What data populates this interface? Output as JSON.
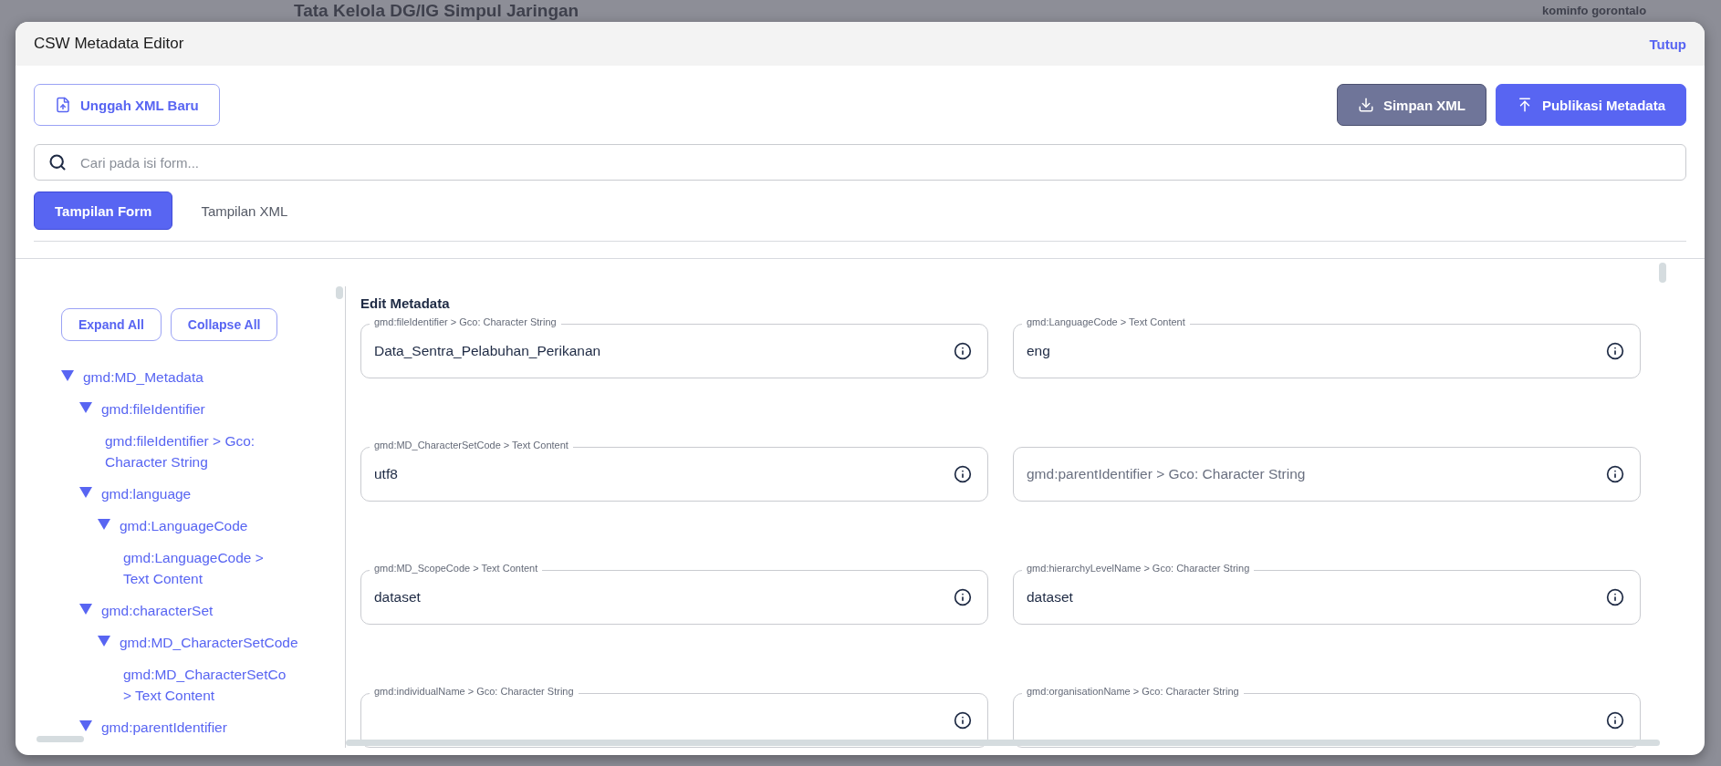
{
  "backdrop": {
    "page_title": "Tata Kelola DG/IG Simpul Jaringan",
    "user": "kominfo gorontalo"
  },
  "window": {
    "title": "CSW Metadata Editor",
    "close_label": "Tutup"
  },
  "toolbar": {
    "upload_button": "Unggah XML Baru",
    "save_button": "Simpan XML",
    "publish_button": "Publikasi Metadata"
  },
  "search": {
    "placeholder": "Cari pada isi form..."
  },
  "tabs": [
    {
      "label": "Tampilan Form",
      "selected": true
    },
    {
      "label": "Tampilan XML",
      "selected": false
    }
  ],
  "tree_buttons": [
    "Expand All",
    "Collapse All"
  ],
  "tree": [
    {
      "label": "gmd:MD_Metadata",
      "expanded": true,
      "children": [
        {
          "label": "gmd:fileIdentifier",
          "expanded": true,
          "children": [
            {
              "label": "gmd:fileIdentifier > Gco: Character String"
            }
          ]
        },
        {
          "label": "gmd:language",
          "expanded": true,
          "children": [
            {
              "label": "gmd:LanguageCode",
              "expanded": true,
              "children": [
                {
                  "label": "gmd:LanguageCode > Text Content"
                }
              ]
            }
          ]
        },
        {
          "label": "gmd:characterSet",
          "expanded": true,
          "children": [
            {
              "label": "gmd:MD_CharacterSetCode",
              "expanded": true,
              "children": [
                {
                  "label": "gmd:MD_CharacterSetCo > Text Content"
                }
              ]
            }
          ]
        },
        {
          "label": "gmd:parentIdentifier",
          "expanded": true
        }
      ]
    }
  ],
  "form": {
    "title": "Edit Metadata",
    "fields": [
      {
        "label": "gmd:fileIdentifier > Gco: Character String",
        "value": "Data_Sentra_Pelabuhan_Perikanan"
      },
      {
        "label": "gmd:LanguageCode > Text Content",
        "value": "eng"
      },
      {
        "label": "gmd:MD_CharacterSetCode > Text Content",
        "value": "utf8"
      },
      {
        "placeholder": "gmd:parentIdentifier > Gco: Character String"
      },
      {
        "label": "gmd:MD_ScopeCode > Text Content",
        "value": "dataset"
      },
      {
        "label": "gmd:hierarchyLevelName > Gco: Character String",
        "value": "dataset"
      },
      {
        "label": "gmd:individualName > Gco: Character String"
      },
      {
        "label": "gmd:organisationName > Gco: Character String"
      }
    ]
  }
}
